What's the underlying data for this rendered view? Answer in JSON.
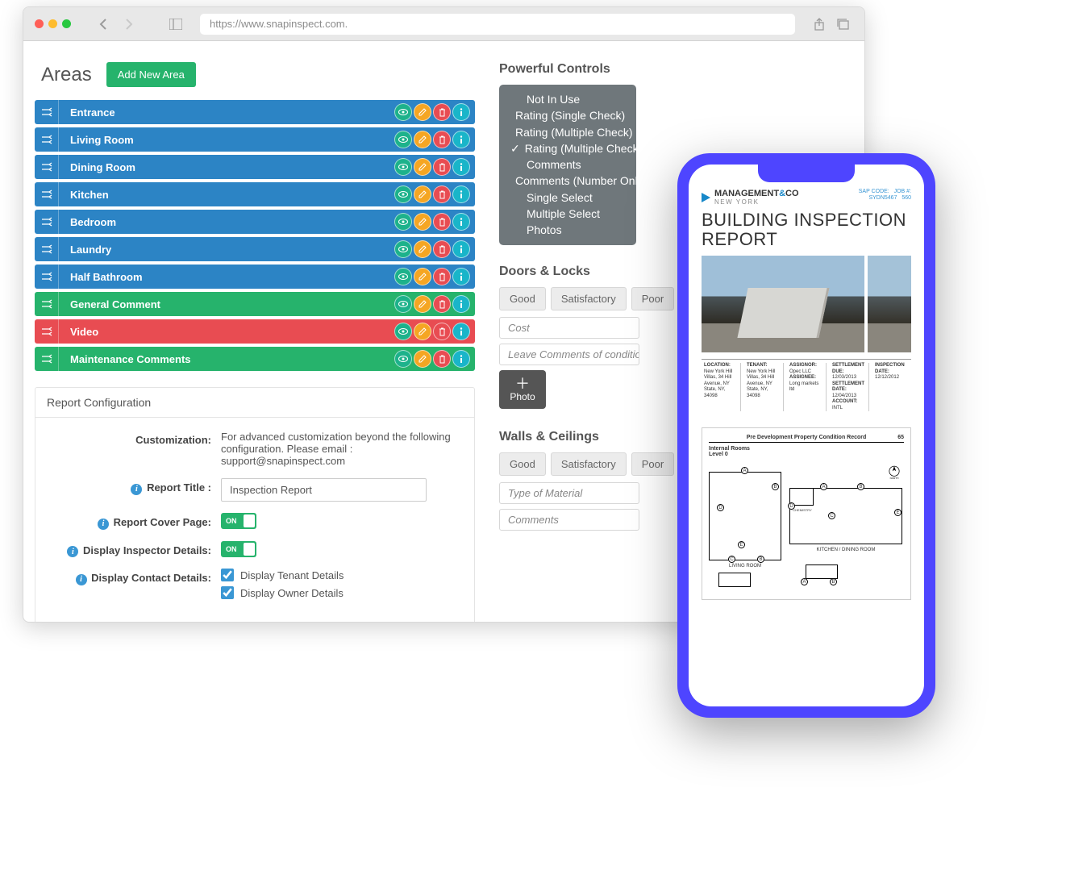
{
  "browser": {
    "url": "https://www.snapinspect.com."
  },
  "areas": {
    "title": "Areas",
    "add_btn": "Add New Area",
    "rows": [
      {
        "label": "Entrance",
        "color": "c-blue"
      },
      {
        "label": "Living Room",
        "color": "c-blue"
      },
      {
        "label": "Dining Room",
        "color": "c-blue"
      },
      {
        "label": "Kitchen",
        "color": "c-blue"
      },
      {
        "label": "Bedroom",
        "color": "c-blue"
      },
      {
        "label": "Laundry",
        "color": "c-blue"
      },
      {
        "label": "Half Bathroom",
        "color": "c-blue"
      },
      {
        "label": "General Comment",
        "color": "c-green"
      },
      {
        "label": "Video",
        "color": "c-red"
      },
      {
        "label": "Maintenance Comments",
        "color": "c-green"
      }
    ]
  },
  "config": {
    "panel_title": "Report Configuration",
    "customization_label": "Customization:",
    "customization_text": "For advanced customization beyond the following configuration. Please email : support@snapinspect.com",
    "title_label": "Report Title :",
    "title_value": "Inspection Report",
    "cover_label": "Report Cover Page:",
    "inspector_label": "Display Inspector Details:",
    "contact_label": "Display Contact Details:",
    "tenant_chk": "Display Tenant Details",
    "owner_chk": "Display Owner Details",
    "on_text": "ON"
  },
  "controls": {
    "title": "Powerful Controls",
    "items": [
      "Not In Use",
      "Rating (Single Check)",
      "Rating (Multiple Check)",
      "Rating (Multiple Check With Colour)",
      "Comments",
      "Comments (Number Only)",
      "Single Select",
      "Multiple Select",
      "Photos"
    ],
    "selected_index": 3
  },
  "doors": {
    "title": "Doors & Locks",
    "pills": [
      "Good",
      "Satisfactory",
      "Poor"
    ],
    "fields": [
      "Cost",
      "Leave Comments of condition"
    ],
    "photo_label": "Photo"
  },
  "walls": {
    "title": "Walls & Ceilings",
    "pills": [
      "Good",
      "Satisfactory",
      "Poor"
    ],
    "fields": [
      "Type of Material",
      "Comments"
    ]
  },
  "phone": {
    "logo_brand": "MANAGEMENT",
    "logo_amp": "&",
    "logo_co": "CO",
    "logo_sub": "NEW YORK",
    "sap_label": "SAP CODE:",
    "sap_val": "SYDN5467",
    "job_label": "JOB #:",
    "job_val": "560",
    "report_title": "BUILDING INSPECTION REPORT",
    "meta": [
      {
        "h": "LOCATION:",
        "v": "New York Hill Villas, 34 Hill Avenue, NY State, NY, 34098"
      },
      {
        "h": "TENANT:",
        "v": "New York Hill Villas, 34 Hill Avenue, NY State, NY, 34098"
      },
      {
        "h": "ASSIGNOR:",
        "v": "Opec LLC",
        "h2": "ASSIGNEE:",
        "v2": "Long markets ltd"
      },
      {
        "h": "SETTLEMENT DUE:",
        "v": "12/03/2013",
        "h2": "SETTLEMENT DATE:",
        "v2": "12/04/2013",
        "h3": "ACCOUNT:",
        "v3": "INTL"
      },
      {
        "h": "INSPECTION DATE:",
        "v": "12/12/2012"
      }
    ],
    "fp_title": "Pre Development Property Condition Record",
    "fp_page": "65",
    "fp_h1": "Internal Rooms",
    "fp_h2": "Level 0",
    "room_living": "LIVING ROOM",
    "room_kitchen": "KITCHEN / DINING ROOM",
    "room_chem": "CHEMISTRY",
    "compass_n": "NORTH"
  }
}
